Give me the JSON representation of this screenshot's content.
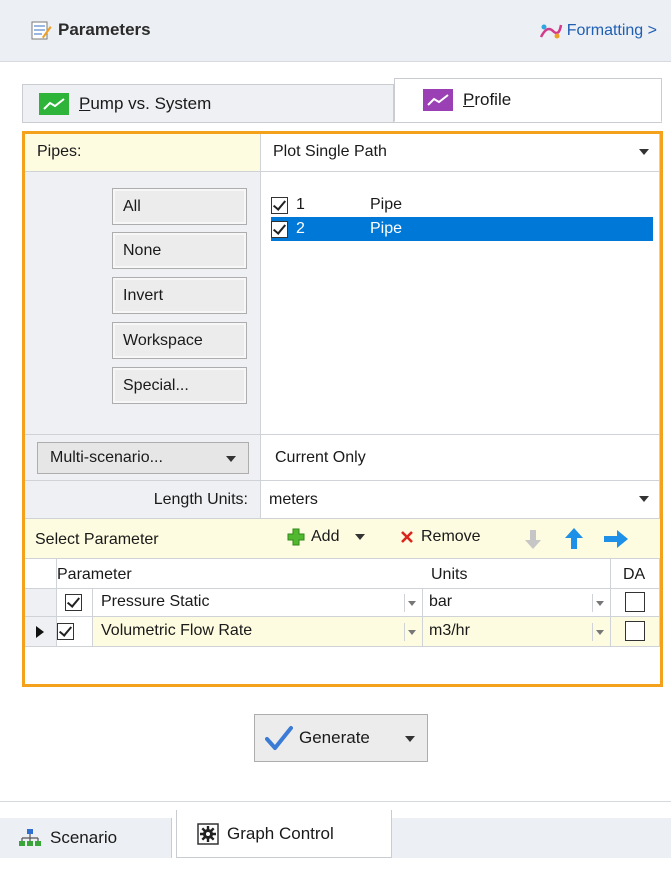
{
  "header": {
    "title": "Parameters",
    "formatting": "Formatting >"
  },
  "tabs": [
    {
      "prefix": "",
      "underlined": "P",
      "rest": "ump vs. System"
    },
    {
      "prefix": "",
      "underlined": "P",
      "rest": "rofile"
    }
  ],
  "pipes": {
    "label": "Pipes:",
    "mode": "Plot Single Path"
  },
  "selection_buttons": [
    "All",
    "None",
    "Invert",
    "Workspace",
    "Special..."
  ],
  "pipe_list": [
    {
      "id": "1",
      "name": "Pipe",
      "checked": true,
      "selected": false
    },
    {
      "id": "2",
      "name": "Pipe",
      "checked": true,
      "selected": true
    }
  ],
  "multi_scenario": {
    "button": "Multi-scenario...",
    "value": "Current Only"
  },
  "length_units": {
    "label": "Length Units:",
    "value": "meters"
  },
  "select_parameter": {
    "label": "Select Parameter",
    "add": "Add",
    "remove": "Remove"
  },
  "grid": {
    "headers": {
      "parameter": "Parameter",
      "units": "Units",
      "da": "DA"
    },
    "rows": [
      {
        "parameter": "Pressure Static",
        "units": "bar",
        "checked": true,
        "da": false,
        "current": false
      },
      {
        "parameter": "Volumetric Flow Rate",
        "units": "m3/hr",
        "checked": true,
        "da": false,
        "current": true
      }
    ]
  },
  "generate": "Generate",
  "bottom_tabs": [
    "Scenario",
    "Graph Control"
  ],
  "colors": {
    "accent_frame": "#f4a21b",
    "selection": "#0078d7",
    "tab_green": "#2fb43a",
    "tab_purple": "#9b3fb5"
  }
}
